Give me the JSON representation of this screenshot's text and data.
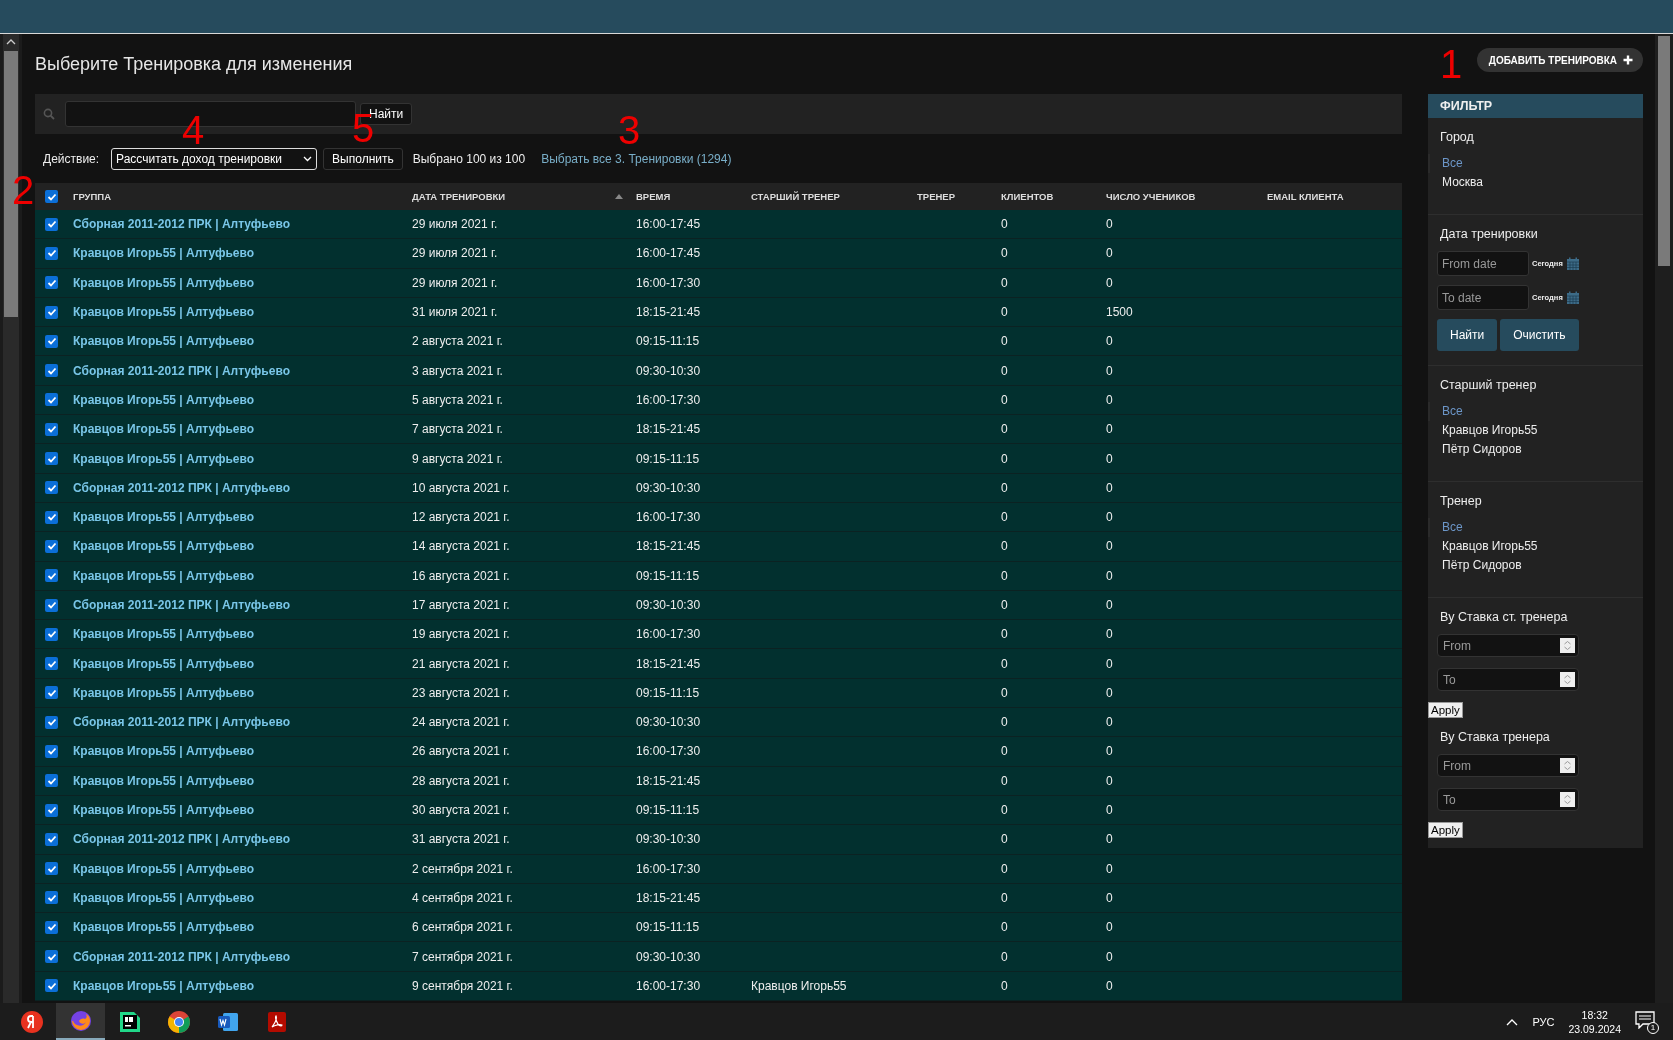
{
  "page": {
    "title": "Выберите Тренировка для изменения",
    "add_button": "ДОБАВИТЬ ТРЕНИРОВКА"
  },
  "search": {
    "button": "Найти"
  },
  "actions": {
    "label": "Действие:",
    "selected_action": "Рассчитать доход тренировки",
    "run_button": "Выполнить",
    "counter": "Выбрано 100 из 100",
    "select_all_link": "Выбрать все 3. Тренировки (1294)"
  },
  "table": {
    "all_checked": true,
    "columns": [
      "ГРУППА",
      "ДАТА ТРЕНИРОВКИ",
      "ВРЕМЯ",
      "СТАРШИЙ ТРЕНЕР",
      "ТРЕНЕР",
      "КЛИЕНТОВ",
      "ЧИСЛО УЧЕНИКОВ",
      "EMAIL КЛИЕНТА"
    ],
    "rows": [
      {
        "checked": true,
        "group": "Сборная 2011-2012 ПРК | Алтуфьево",
        "date": "29 июля 2021 г.",
        "time": "16:00-17:45",
        "clients": "0",
        "students": "0"
      },
      {
        "checked": true,
        "group": "Кравцов Игорь55 | Алтуфьево",
        "date": "29 июля 2021 г.",
        "time": "16:00-17:45",
        "clients": "0",
        "students": "0"
      },
      {
        "checked": true,
        "group": "Кравцов Игорь55 | Алтуфьево",
        "date": "29 июля 2021 г.",
        "time": "16:00-17:30",
        "clients": "0",
        "students": "0"
      },
      {
        "checked": true,
        "group": "Кравцов Игорь55 | Алтуфьево",
        "date": "31 июля 2021 г.",
        "time": "18:15-21:45",
        "clients": "0",
        "students": "1500"
      },
      {
        "checked": true,
        "group": "Кравцов Игорь55 | Алтуфьево",
        "date": "2 августа 2021 г.",
        "time": "09:15-11:15",
        "clients": "0",
        "students": "0"
      },
      {
        "checked": true,
        "group": "Сборная 2011-2012 ПРК | Алтуфьево",
        "date": "3 августа 2021 г.",
        "time": "09:30-10:30",
        "clients": "0",
        "students": "0"
      },
      {
        "checked": true,
        "group": "Кравцов Игорь55 | Алтуфьево",
        "date": "5 августа 2021 г.",
        "time": "16:00-17:30",
        "clients": "0",
        "students": "0"
      },
      {
        "checked": true,
        "group": "Кравцов Игорь55 | Алтуфьево",
        "date": "7 августа 2021 г.",
        "time": "18:15-21:45",
        "clients": "0",
        "students": "0"
      },
      {
        "checked": true,
        "group": "Кравцов Игорь55 | Алтуфьево",
        "date": "9 августа 2021 г.",
        "time": "09:15-11:15",
        "clients": "0",
        "students": "0"
      },
      {
        "checked": true,
        "group": "Сборная 2011-2012 ПРК | Алтуфьево",
        "date": "10 августа 2021 г.",
        "time": "09:30-10:30",
        "clients": "0",
        "students": "0"
      },
      {
        "checked": true,
        "group": "Кравцов Игорь55 | Алтуфьево",
        "date": "12 августа 2021 г.",
        "time": "16:00-17:30",
        "clients": "0",
        "students": "0"
      },
      {
        "checked": true,
        "group": "Кравцов Игорь55 | Алтуфьево",
        "date": "14 августа 2021 г.",
        "time": "18:15-21:45",
        "clients": "0",
        "students": "0"
      },
      {
        "checked": true,
        "group": "Кравцов Игорь55 | Алтуфьево",
        "date": "16 августа 2021 г.",
        "time": "09:15-11:15",
        "clients": "0",
        "students": "0"
      },
      {
        "checked": true,
        "group": "Сборная 2011-2012 ПРК | Алтуфьево",
        "date": "17 августа 2021 г.",
        "time": "09:30-10:30",
        "clients": "0",
        "students": "0"
      },
      {
        "checked": true,
        "group": "Кравцов Игорь55 | Алтуфьево",
        "date": "19 августа 2021 г.",
        "time": "16:00-17:30",
        "clients": "0",
        "students": "0"
      },
      {
        "checked": true,
        "group": "Кравцов Игорь55 | Алтуфьево",
        "date": "21 августа 2021 г.",
        "time": "18:15-21:45",
        "clients": "0",
        "students": "0"
      },
      {
        "checked": true,
        "group": "Кравцов Игорь55 | Алтуфьево",
        "date": "23 августа 2021 г.",
        "time": "09:15-11:15",
        "clients": "0",
        "students": "0"
      },
      {
        "checked": true,
        "group": "Сборная 2011-2012 ПРК | Алтуфьево",
        "date": "24 августа 2021 г.",
        "time": "09:30-10:30",
        "clients": "0",
        "students": "0"
      },
      {
        "checked": true,
        "group": "Кравцов Игорь55 | Алтуфьево",
        "date": "26 августа 2021 г.",
        "time": "16:00-17:30",
        "clients": "0",
        "students": "0"
      },
      {
        "checked": true,
        "group": "Кравцов Игорь55 | Алтуфьево",
        "date": "28 августа 2021 г.",
        "time": "18:15-21:45",
        "clients": "0",
        "students": "0"
      },
      {
        "checked": true,
        "group": "Кравцов Игорь55 | Алтуфьево",
        "date": "30 августа 2021 г.",
        "time": "09:15-11:15",
        "clients": "0",
        "students": "0"
      },
      {
        "checked": true,
        "group": "Сборная 2011-2012 ПРК | Алтуфьево",
        "date": "31 августа 2021 г.",
        "time": "09:30-10:30",
        "clients": "0",
        "students": "0"
      },
      {
        "checked": true,
        "group": "Кравцов Игорь55 | Алтуфьево",
        "date": "2 сентября 2021 г.",
        "time": "16:00-17:30",
        "clients": "0",
        "students": "0"
      },
      {
        "checked": true,
        "group": "Кравцов Игорь55 | Алтуфьево",
        "date": "4 сентября 2021 г.",
        "time": "18:15-21:45",
        "clients": "0",
        "students": "0"
      },
      {
        "checked": true,
        "group": "Кравцов Игорь55 | Алтуфьево",
        "date": "6 сентября 2021 г.",
        "time": "09:15-11:15",
        "clients": "0",
        "students": "0"
      },
      {
        "checked": true,
        "group": "Сборная 2011-2012 ПРК | Алтуфьево",
        "date": "7 сентября 2021 г.",
        "time": "09:30-10:30",
        "clients": "0",
        "students": "0"
      },
      {
        "checked": true,
        "group": "Кравцов Игорь55 | Алтуфьево",
        "date": "9 сентября 2021 г.",
        "time": "16:00-17:30",
        "senior_trainer": "Кравцов Игорь55",
        "clients": "0",
        "students": "0"
      }
    ]
  },
  "filter": {
    "title": "ФИЛЬТР",
    "sections": [
      {
        "kind": "list",
        "title": "Город",
        "options": [
          {
            "label": "Все",
            "selected": true
          },
          {
            "label": "Москва",
            "selected": false
          }
        ]
      },
      {
        "kind": "date",
        "title": "Дата тренировки",
        "fields": [
          {
            "placeholder": "From date",
            "shortcut": "Сегодня"
          },
          {
            "placeholder": "To date",
            "shortcut": "Сегодня"
          }
        ],
        "buttons": [
          "Найти",
          "Очистить"
        ]
      },
      {
        "kind": "list",
        "title": "Старший тренер",
        "options": [
          {
            "label": "Все",
            "selected": true
          },
          {
            "label": "Кравцов Игорь55",
            "selected": false
          },
          {
            "label": "Пётр Сидоров",
            "selected": false
          }
        ]
      },
      {
        "kind": "list",
        "title": "Тренер",
        "options": [
          {
            "label": "Все",
            "selected": true
          },
          {
            "label": "Кравцов Игорь55",
            "selected": false
          },
          {
            "label": "Пётр Сидоров",
            "selected": false
          }
        ]
      },
      {
        "kind": "range",
        "title": "By Ставка ст. тренера",
        "fields": [
          {
            "placeholder": "From"
          },
          {
            "placeholder": "To"
          }
        ],
        "button": "Apply"
      },
      {
        "kind": "range",
        "title": "By Ставка тренера",
        "fields": [
          {
            "placeholder": "From"
          },
          {
            "placeholder": "To"
          }
        ],
        "button": "Apply"
      }
    ]
  },
  "annotations": [
    "1",
    "4",
    "5",
    "3",
    "2"
  ],
  "taskbar": {
    "language": "РУС",
    "time": "18:32",
    "date": "23.09.2024",
    "notifications": "1"
  }
}
